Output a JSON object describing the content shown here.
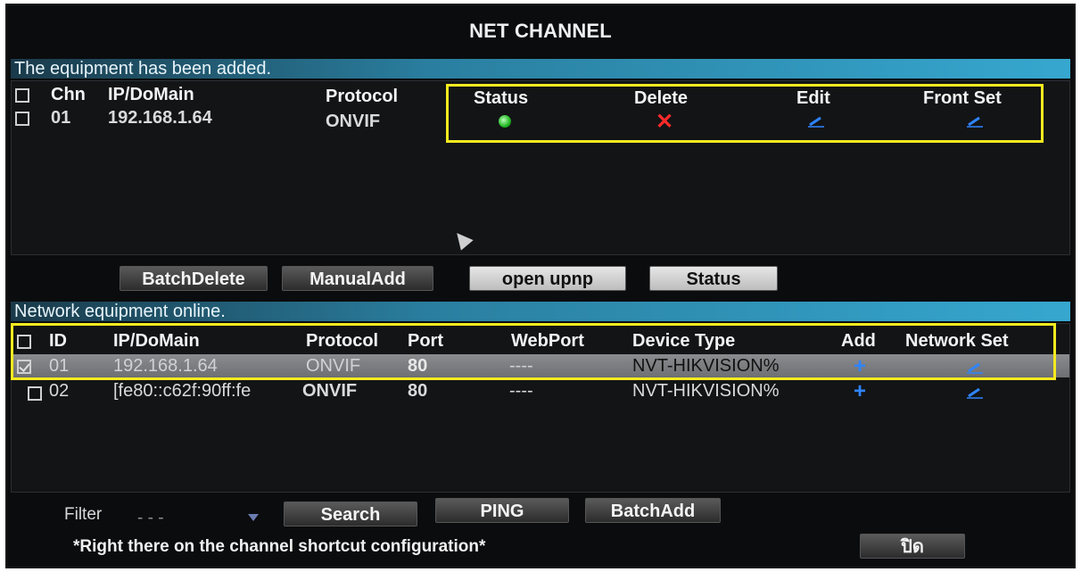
{
  "window": {
    "title": "NET CHANNEL"
  },
  "added": {
    "section_title": "The equipment has been added.",
    "columns": {
      "chn": "Chn",
      "ip": "IP/DoMain",
      "protocol": "Protocol",
      "status": "Status",
      "delete": "Delete",
      "edit": "Edit",
      "front_set": "Front Set"
    },
    "rows": [
      {
        "chn": "01",
        "ip": "192.168.1.64",
        "protocol": "ONVIF",
        "status_color": "#1fb51f"
      }
    ],
    "buttons": {
      "batch_delete": "BatchDelete",
      "manual_add": "ManualAdd",
      "open_upnp": "open upnp",
      "status": "Status"
    }
  },
  "online": {
    "section_title": "Network equipment online.",
    "columns": {
      "id": "ID",
      "ip": "IP/DoMain",
      "protocol": "Protocol",
      "port": "Port",
      "webport": "WebPort",
      "device_type": "Device Type",
      "add": "Add",
      "network_set": "Network Set"
    },
    "rows": [
      {
        "id": "01",
        "ip": "192.168.1.64",
        "protocol": "ONVIF",
        "port": "80",
        "webport": "----",
        "device_type": "NVT-HIKVISION%",
        "checked": true
      },
      {
        "id": "02",
        "ip": "[fe80::c62f:90ff:fe",
        "protocol": "ONVIF",
        "port": "80",
        "webport": "----",
        "device_type": "NVT-HIKVISION%",
        "checked": false
      }
    ]
  },
  "footer": {
    "filter_label": "Filter",
    "filter_value": "- - -",
    "search": "Search",
    "ping": "PING",
    "batch_add": "BatchAdd",
    "hint": "*Right there on the channel shortcut configuration*",
    "close": "ปิด"
  },
  "colors": {
    "highlight": "#f5ea1f",
    "section_bar": "#36a7cf",
    "icon_blue": "#2f84ff",
    "delete_red": "#ff2a2a"
  }
}
